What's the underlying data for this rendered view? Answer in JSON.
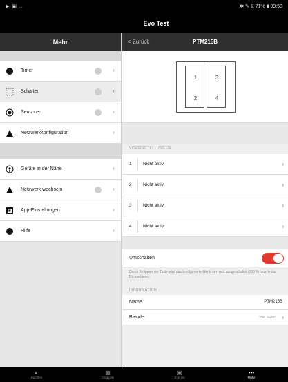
{
  "status": {
    "left": "▶ ▣ ..",
    "right": "✱ ✎ ⧖ 71% ▮ 09:53"
  },
  "app_title": "Evo Test",
  "sidebar": {
    "title": "Mehr",
    "group1": [
      {
        "label": "Timer",
        "icon": "timer-icon"
      },
      {
        "label": "Schalter",
        "icon": "switch-icon"
      },
      {
        "label": "Sensoren",
        "icon": "sensor-icon"
      },
      {
        "label": "Netzwerkkonfiguration",
        "icon": "network-config-icon"
      }
    ],
    "group2": [
      {
        "label": "Geräte in der Nähe",
        "icon": "nearby-devices-icon"
      },
      {
        "label": "Netzwerk wechseln",
        "icon": "switch-network-icon"
      },
      {
        "label": "App-Einstellungen",
        "icon": "app-settings-icon"
      },
      {
        "label": "Hilfe",
        "icon": "help-icon"
      }
    ]
  },
  "main": {
    "back": "< Zurück",
    "title": "PTM215B",
    "device_buttons": [
      "1",
      "2",
      "3",
      "4"
    ],
    "presets_label": "VOREINSTELLUNGEN",
    "presets": [
      {
        "num": "1",
        "value": "Nicht aktiv"
      },
      {
        "num": "2",
        "value": "Nicht aktiv"
      },
      {
        "num": "3",
        "value": "Nicht aktiv"
      },
      {
        "num": "4",
        "value": "Nicht aktiv"
      }
    ],
    "toggle_label": "Umschalten",
    "toggle_on": true,
    "hint": "Durch Antippen der Taste wird das konfigurierte Gerät ein- und ausgeschaltet (100 % bzw. letzte Dimmebene).",
    "info_label": "INFORMATION",
    "name_key": "Name",
    "name_value": "PTM215B",
    "blende_key": "Blende",
    "blende_value": "Vier Taster"
  },
  "tabs": [
    {
      "label": "Leuchten",
      "icon": "lamp-icon"
    },
    {
      "label": "Gruppen",
      "icon": "groups-icon"
    },
    {
      "label": "Szenen",
      "icon": "scenes-icon"
    },
    {
      "label": "Mehr",
      "icon": "more-icon"
    }
  ],
  "colors": {
    "accent": "#e03a2e",
    "bar": "#2f2f2f"
  }
}
